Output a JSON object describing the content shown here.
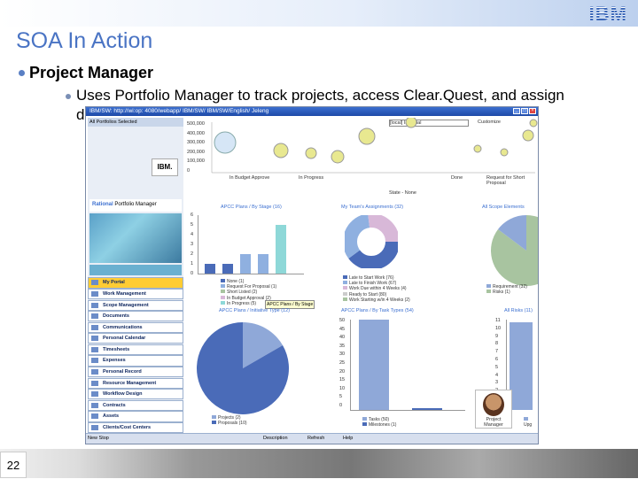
{
  "header": {
    "logo": "IBM",
    "title": "SOA In Action",
    "page_number": "22"
  },
  "bullets": {
    "level1": "Project Manager",
    "level2_line1": "Uses Portfolio Manager to track projects, access Clear.Quest, and assign",
    "level2_line2": "de"
  },
  "screenshot": {
    "window_title": "IBM/SW: http://wi:op: 4080/webapp/ IBM/SW/ IBM/SW/English/ Jeleng",
    "left_header": "All Portfolios Selected",
    "brand_prefix": "Rational",
    "brand_name": "Portfolio Manager",
    "logo": "IBM.",
    "menu": [
      "My Portal",
      "Work Management",
      "Scope Management",
      "Documents",
      "Communications",
      "Personal Calendar",
      "Timesheets",
      "Expenses",
      "Personal Record",
      "Resource Management",
      "Workflow Design",
      "Contracts",
      "Assets",
      "Clients/Cost Centers"
    ],
    "status": "New Stop",
    "status_buttons": [
      "Description",
      "Refresh",
      "Help"
    ],
    "top_filter": "[local] Imperial",
    "top_filter2": "Customize",
    "bubble_yticks": [
      "500,000",
      "400,000",
      "300,000",
      "200,000",
      "100,000",
      "0"
    ],
    "bubble_xlabels": [
      "In Budget Approve",
      "In Progress",
      "Done",
      "Request for Short Proposal"
    ],
    "bubble_caption": "State - None",
    "chart1_title": "APCC Plans / By Stage (16)",
    "chart1_yticks": [
      "6",
      "5",
      "4",
      "3",
      "2",
      "1",
      "0"
    ],
    "chart1_legend": [
      "None (1)",
      "Request For Proposal (1)",
      "Short Listed (2)",
      "In Budget Approval (2)",
      "In Progress (5)"
    ],
    "tooltip": "APCC Plans / By Stage",
    "chart2_title": "My Team's Assignments (32)",
    "chart2_legend": [
      "Late to Start Work (76)",
      "Late to Finish Work (67)",
      "Work Due within 4 Weeks (4)",
      "Ready to Start (80)",
      "Work Starting w/in 4 Weeks (2)"
    ],
    "chart3_title": "All Scope Elements",
    "chart3_legend": [
      "Requirement (32)",
      "Risks (1)"
    ],
    "chart4_title": "APCC Plans / Initiative Type (12)",
    "chart4_legend": [
      "Projects (2)",
      "Proposals (10)"
    ],
    "chart5_title": "APCC Plans / By Task Types (54)",
    "chart5_yticks": [
      "50",
      "45",
      "40",
      "35",
      "30",
      "25",
      "20",
      "15",
      "10",
      "5",
      "0"
    ],
    "chart5_legend": [
      "Tasks (50)",
      "Milestones (1)"
    ],
    "chart6_title": "All Risks (11)",
    "chart6_yticks": [
      "11",
      "10",
      "9",
      "8",
      "7",
      "6",
      "5",
      "4",
      "3",
      "2",
      "1",
      "0"
    ],
    "chart6_legend": [
      "Upg"
    ],
    "avatar_label": "Project Manager"
  },
  "chart_data": [
    {
      "type": "bar",
      "title": "APCC Plans / By Stage (16)",
      "categories": [
        "None",
        "Request For Proposal",
        "Short Listed",
        "In Budget Approval",
        "In Progress"
      ],
      "values": [
        1,
        1,
        2,
        2,
        5
      ],
      "ylim": [
        0,
        6
      ]
    },
    {
      "type": "bar",
      "title": "APCC Plans / By Task Types (54)",
      "categories": [
        "Tasks",
        "Milestones"
      ],
      "values": [
        50,
        1
      ],
      "ylim": [
        0,
        50
      ]
    },
    {
      "type": "pie",
      "title": "APCC Plans / Initiative Type (12)",
      "categories": [
        "Projects",
        "Proposals"
      ],
      "values": [
        2,
        10
      ]
    }
  ],
  "colors": {
    "accent": "#4a74c4",
    "menu_active": "#ffcc33",
    "bar1": "#4a6bb8",
    "bar2": "#8fb0e0",
    "bar_teal": "#8ed8d8"
  }
}
